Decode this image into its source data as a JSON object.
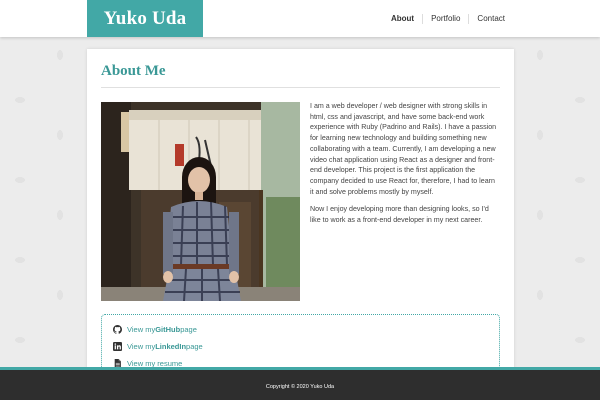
{
  "header": {
    "logo": "Yuko Uda",
    "nav": [
      {
        "label": "About"
      },
      {
        "label": "Portfolio"
      },
      {
        "label": "Contact"
      }
    ]
  },
  "main": {
    "title": "About Me",
    "photo_alt": "profile-photo",
    "bio": [
      "I am a web developer / web designer with strong skills in html, css and javascript, and have some back-end work experience with Ruby (Padrino and Rails). I have a passion for learning new technology and building something new collaborating with a team. Currently, I am developing a new video chat application using React as a designer and front-end developer. This project is the first application the company decided to use React for, therefore, I had to learn it and solve problems mostly by myself.",
      "Now I enjoy developing more than designing looks, so I'd like to work as a front-end developer in my next career."
    ],
    "links": [
      {
        "prefix": "View my ",
        "bold": "GitHub",
        "suffix": " page",
        "icon": "github-icon"
      },
      {
        "prefix": "View my ",
        "bold": "LinkedIn",
        "suffix": " page",
        "icon": "linkedin-icon"
      },
      {
        "prefix": "View my resume",
        "bold": "",
        "suffix": "",
        "icon": "document-icon"
      }
    ]
  },
  "footer": {
    "copyright": "Copyright © 2020 Yuko Uda"
  },
  "colors": {
    "accent": "#42a8a6",
    "footer": "#2e2e2e"
  }
}
